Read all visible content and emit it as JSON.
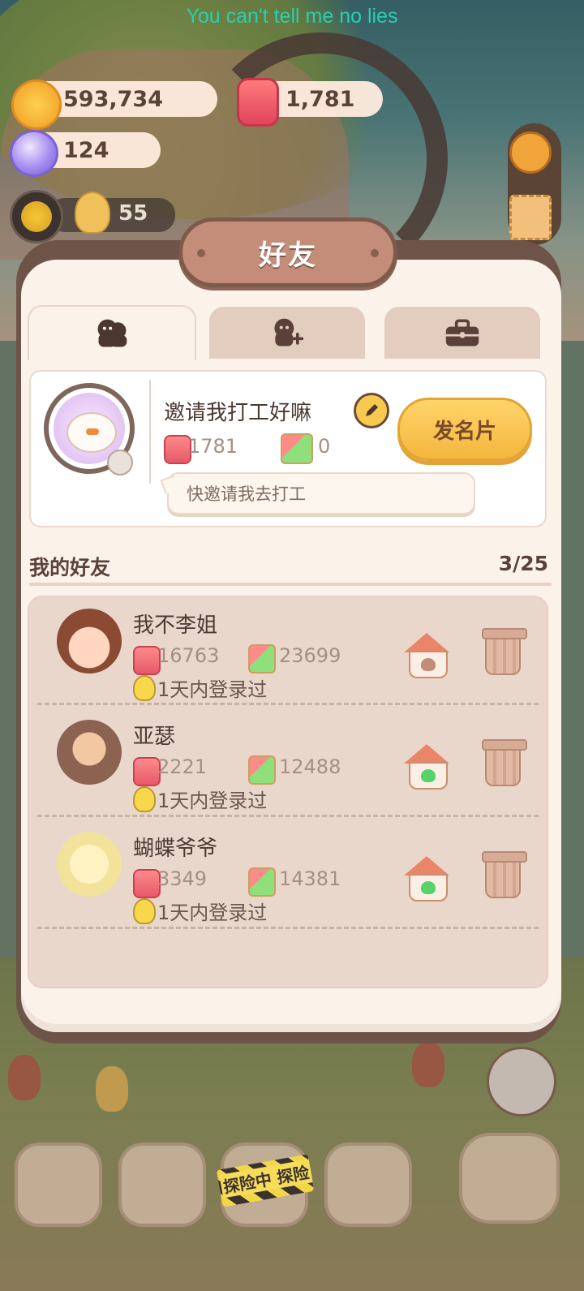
{
  "overlay_caption": "You can't tell me no lies",
  "resources": {
    "coins": "593,734",
    "candles": "1,781",
    "gems": "124",
    "level": "55"
  },
  "dialog": {
    "title": "好友",
    "tabs": [
      {
        "name": "friends-list",
        "icon": "friends-icon",
        "active": true
      },
      {
        "name": "add-friend",
        "icon": "add-friend-icon",
        "active": false
      },
      {
        "name": "inventory",
        "icon": "briefcase-icon",
        "active": false
      }
    ]
  },
  "profile": {
    "name": "邀请我打工好嘛",
    "candle_count": "1781",
    "gift_count": "0",
    "message": "快邀请我去打工",
    "send_card_label": "发名片"
  },
  "friends": {
    "title": "我的好友",
    "count": "3/25",
    "items": [
      {
        "name": "我不李姐",
        "candles": "16763",
        "gifts": "23699",
        "last_login": "1天内登录过",
        "home_heart": "brown"
      },
      {
        "name": "亚瑟",
        "candles": "2221",
        "gifts": "12488",
        "last_login": "1天内登录过",
        "home_heart": "green"
      },
      {
        "name": "蝴蝶爷爷",
        "candles": "3349",
        "gifts": "14381",
        "last_login": "1天内登录过",
        "home_heart": "green"
      }
    ]
  },
  "bottom_nav": {
    "explore_tape": "探险中 探险"
  },
  "colors": {
    "caption": "#26d0b0",
    "dialog_frame": "#6e5448",
    "dialog_bg": "#fbf2ea",
    "send_button": "#f4b63d",
    "list_bg": "#ead7cc"
  }
}
